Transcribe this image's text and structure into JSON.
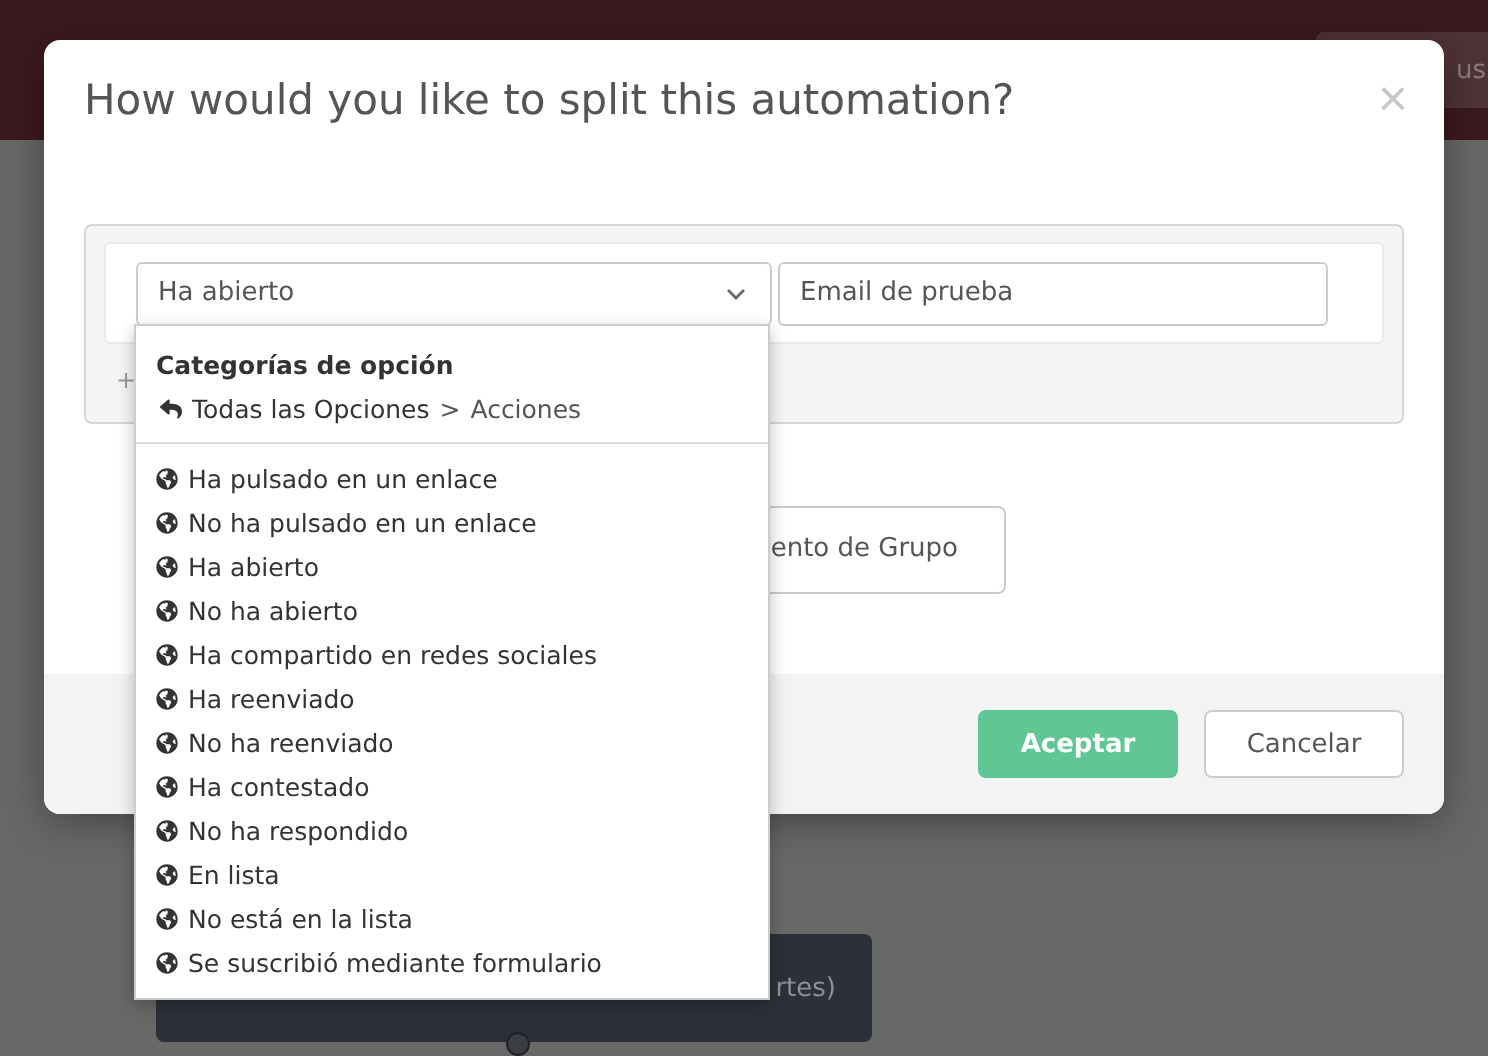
{
  "header": {
    "button": "us"
  },
  "dialog": {
    "title": "How would you like to split this automation?",
    "close": "×",
    "condition": {
      "select_value": "Ha abierto",
      "value": "Email de prueba",
      "add": "+"
    },
    "group_button": "ento de Grupo",
    "buttons": [
      {
        "label": "Aceptar",
        "kind": "primary"
      },
      {
        "label": "Cancelar",
        "kind": "secondary"
      }
    ]
  },
  "dropdown": {
    "heading": "Categorías de opción",
    "breadcrumb": {
      "link": "Todas las Opciones",
      "separator": ">",
      "current": "Acciones"
    },
    "items": [
      "Ha pulsado en un enlace",
      "No ha pulsado en un enlace",
      "Ha abierto",
      "No ha abierto",
      "Ha compartido en redes sociales",
      "Ha reenviado",
      "No ha reenviado",
      "Ha contestado",
      "No ha respondido",
      "En lista",
      "No está en la lista",
      "Se suscribió mediante formulario"
    ]
  },
  "background_node": {
    "label": "rtes)"
  }
}
